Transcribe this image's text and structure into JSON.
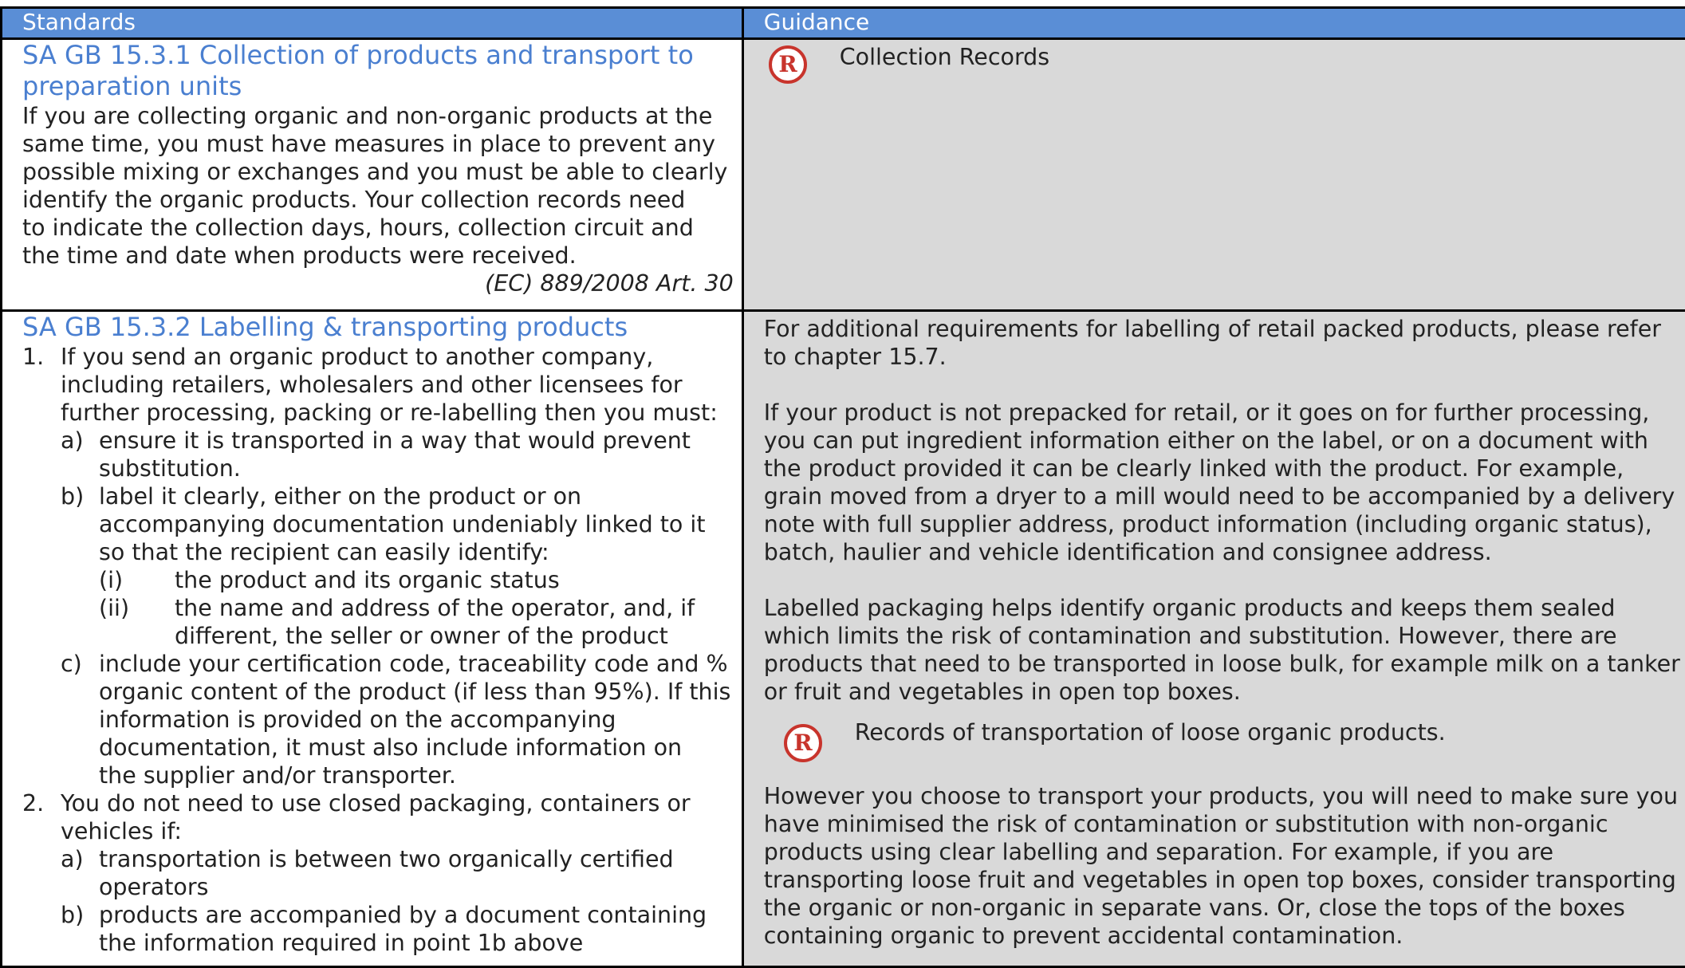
{
  "header": {
    "standards_label": "Standards",
    "guidance_label": "Guidance"
  },
  "row1": {
    "title_line1": "SA GB 15.3.1 Collection of products and transport to",
    "title_line2": "preparation units",
    "body_lines": [
      "If you are collecting organic and non-organic products at the",
      "same time, you must have measures in place to prevent any",
      "possible mixing or exchanges and you must be able to clearly",
      "identify the organic products.  Your collection records need",
      "to indicate the collection days, hours, collection circuit and",
      "the time and date when products were received."
    ],
    "reference": "(EC) 889/2008 Art. 30",
    "guidance_record": "Collection Records"
  },
  "row2": {
    "title": "SA GB 15.3.2 Labelling & transporting products",
    "item1_num": "1.",
    "item1_lines": [
      "If you send an organic product to another company,",
      "including retailers, wholesalers and other licensees for",
      "further processing, packing or re-labelling then you must:"
    ],
    "item1a_num": "a)",
    "item1a_lines": [
      "ensure it is transported in a way that would prevent",
      "substitution."
    ],
    "item1b_num": "b)",
    "item1b_lines": [
      "label it clearly, either on the product or on",
      "accompanying documentation undeniably linked to it",
      "so that the recipient can easily identify:"
    ],
    "item1b_i_num": "(i)",
    "item1b_i_text": "the product and its organic status",
    "item1b_ii_num": "(ii)",
    "item1b_ii_lines": [
      "the name and address of the operator, and, if",
      "different, the seller or owner of the product"
    ],
    "item1c_num": "c)",
    "item1c_lines": [
      "include your certification code, traceability code and %",
      "organic content of the product (if less than 95%). If this",
      "information is provided on the accompanying",
      "documentation, it must also include information on",
      "the supplier and/or transporter."
    ],
    "item2_num": "2.",
    "item2_lines": [
      "You do not need to use closed packaging, containers or",
      "vehicles if:"
    ],
    "item2a_num": "a)",
    "item2a_lines": [
      "transportation is between two organically certified",
      "operators"
    ],
    "item2b_num": "b)",
    "item2b_lines": [
      "products are accompanied by a document containing",
      "the information required in point 1b above"
    ],
    "guidance_p1": [
      "For additional requirements for labelling of retail packed products, please refer",
      "to chapter 15.7."
    ],
    "guidance_p2": [
      "If your product is not prepacked for retail, or it goes on for further processing,",
      "you can put ingredient information either on the label, or on a document with",
      "the product provided it can be clearly linked with the product. For example,",
      "grain moved from a dryer to a mill would need to be accompanied by a delivery",
      "note with full supplier address, product information (including organic status),",
      "batch, haulier and vehicle identification and consignee address."
    ],
    "guidance_p3": [
      "Labelled packaging helps identify organic products and keeps them sealed",
      "which limits the risk of contamination and substitution. However, there are",
      "products that need to be transported in loose bulk, for example milk on a tanker",
      "or fruit and vegetables in open top boxes."
    ],
    "guidance_record": "Records of transportation of loose organic products.",
    "guidance_p4": [
      "However you choose to transport your products, you will need to make sure you",
      "have minimised the risk of contamination or substitution with non-organic",
      "products using clear labelling and separation.  For example, if you are",
      "transporting loose fruit and vegetables in open top boxes, consider transporting",
      "the organic or non-organic in separate vans. Or, close the tops of the boxes",
      "containing organic to prevent accidental contamination."
    ]
  },
  "colors": {
    "header_bg": "#5a8ed6",
    "title_blue": "#4a7fd0",
    "guidance_bg": "#d9d9d9",
    "record_icon_red": "#c8342c"
  },
  "icons": [
    "record-r-icon"
  ]
}
